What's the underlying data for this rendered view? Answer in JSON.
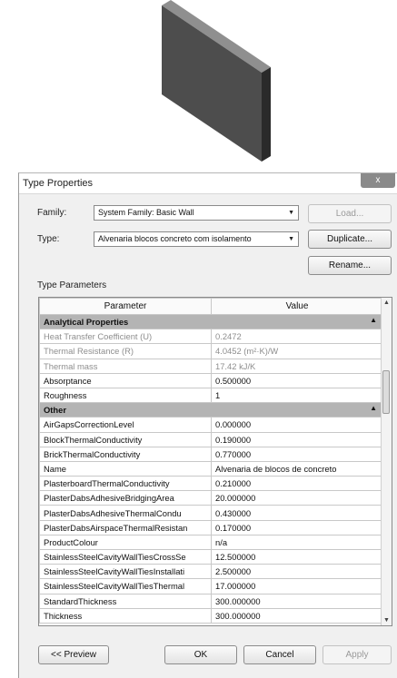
{
  "dialog": {
    "title": "Type Properties",
    "close_label": "x"
  },
  "family": {
    "label": "Family:",
    "value": "System Family: Basic Wall"
  },
  "type": {
    "label": "Type:",
    "value": "Alvenaria blocos concreto com isolamento"
  },
  "buttons": {
    "load": "Load...",
    "duplicate": "Duplicate...",
    "rename": "Rename...",
    "preview": "<< Preview",
    "ok": "OK",
    "cancel": "Cancel",
    "apply": "Apply"
  },
  "type_parameters_label": "Type Parameters",
  "table": {
    "headers": {
      "parameter": "Parameter",
      "value": "Value"
    },
    "groups": [
      {
        "name": "Analytical Properties",
        "rows": [
          {
            "parameter": "Heat Transfer Coefficient (U)",
            "value": "0.2472"
          },
          {
            "parameter": "Thermal Resistance (R)",
            "value": "4.0452 (m²·K)/W"
          },
          {
            "parameter": "Thermal mass",
            "value": "17.42 kJ/K"
          },
          {
            "parameter": "Absorptance",
            "value": "0.500000"
          },
          {
            "parameter": "Roughness",
            "value": "1"
          }
        ]
      },
      {
        "name": "Other",
        "rows": [
          {
            "parameter": "AirGapsCorrectionLevel",
            "value": "0.000000"
          },
          {
            "parameter": "BlockThermalConductivity",
            "value": "0.190000"
          },
          {
            "parameter": "BrickThermalConductivity",
            "value": "0.770000"
          },
          {
            "parameter": "Name",
            "value": "Alvenaria de blocos de concreto"
          },
          {
            "parameter": "PlasterboardThermalConductivity",
            "value": "0.210000"
          },
          {
            "parameter": "PlasterDabsAdhesiveBridgingArea",
            "value": "20.000000"
          },
          {
            "parameter": "PlasterDabsAdhesiveThermalCondu",
            "value": "0.430000"
          },
          {
            "parameter": "PlasterDabsAirspaceThermalResistan",
            "value": "0.170000"
          },
          {
            "parameter": "ProductColour",
            "value": "n/a"
          },
          {
            "parameter": "StainlessSteelCavityWallTiesCrossSe",
            "value": "12.500000"
          },
          {
            "parameter": "StainlessSteelCavityWallTiesInstallati",
            "value": "2.500000"
          },
          {
            "parameter": "StainlessSteelCavityWallTiesThermal",
            "value": "17.000000"
          },
          {
            "parameter": "StandardThickness",
            "value": "300.000000"
          },
          {
            "parameter": "Thickness",
            "value": "300.000000"
          }
        ]
      }
    ]
  }
}
